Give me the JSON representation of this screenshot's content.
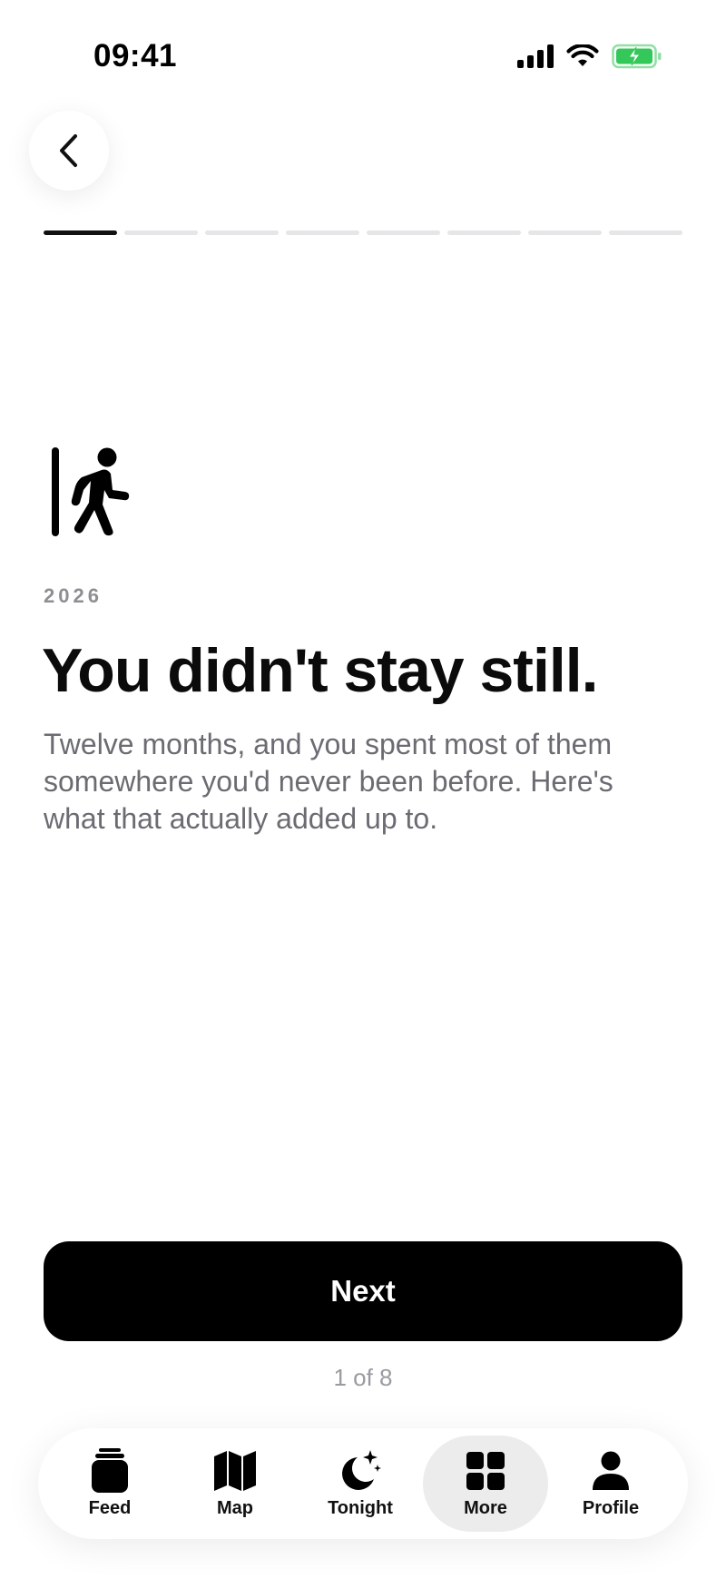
{
  "status_bar": {
    "time": "09:41",
    "signal_icon": "cellular-signal-icon",
    "wifi_icon": "wifi-icon",
    "battery_icon": "battery-charging-icon",
    "battery_color": "#34c759"
  },
  "header": {
    "back_icon": "chevron-left-icon"
  },
  "progress": {
    "total_steps": 8,
    "current_step": 1,
    "active_color": "#111111",
    "inactive_color": "#e6e6e8"
  },
  "content": {
    "icon": "person-walking-out-door-icon",
    "year": "2026",
    "headline": "You didn't stay still.",
    "body": "Twelve months, and you spent most of them somewhere you'd never been before. Here's what that actually added up to."
  },
  "actions": {
    "next_label": "Next",
    "pager_label": "1 of 8"
  },
  "tab_bar": {
    "tabs": [
      {
        "label": "Feed",
        "icon": "feed-stack-icon",
        "active": false
      },
      {
        "label": "Map",
        "icon": "map-icon",
        "active": false
      },
      {
        "label": "Tonight",
        "icon": "moon-stars-icon",
        "active": false
      },
      {
        "label": "More",
        "icon": "grid-icon",
        "active": true
      },
      {
        "label": "Profile",
        "icon": "person-icon",
        "active": false
      }
    ]
  }
}
